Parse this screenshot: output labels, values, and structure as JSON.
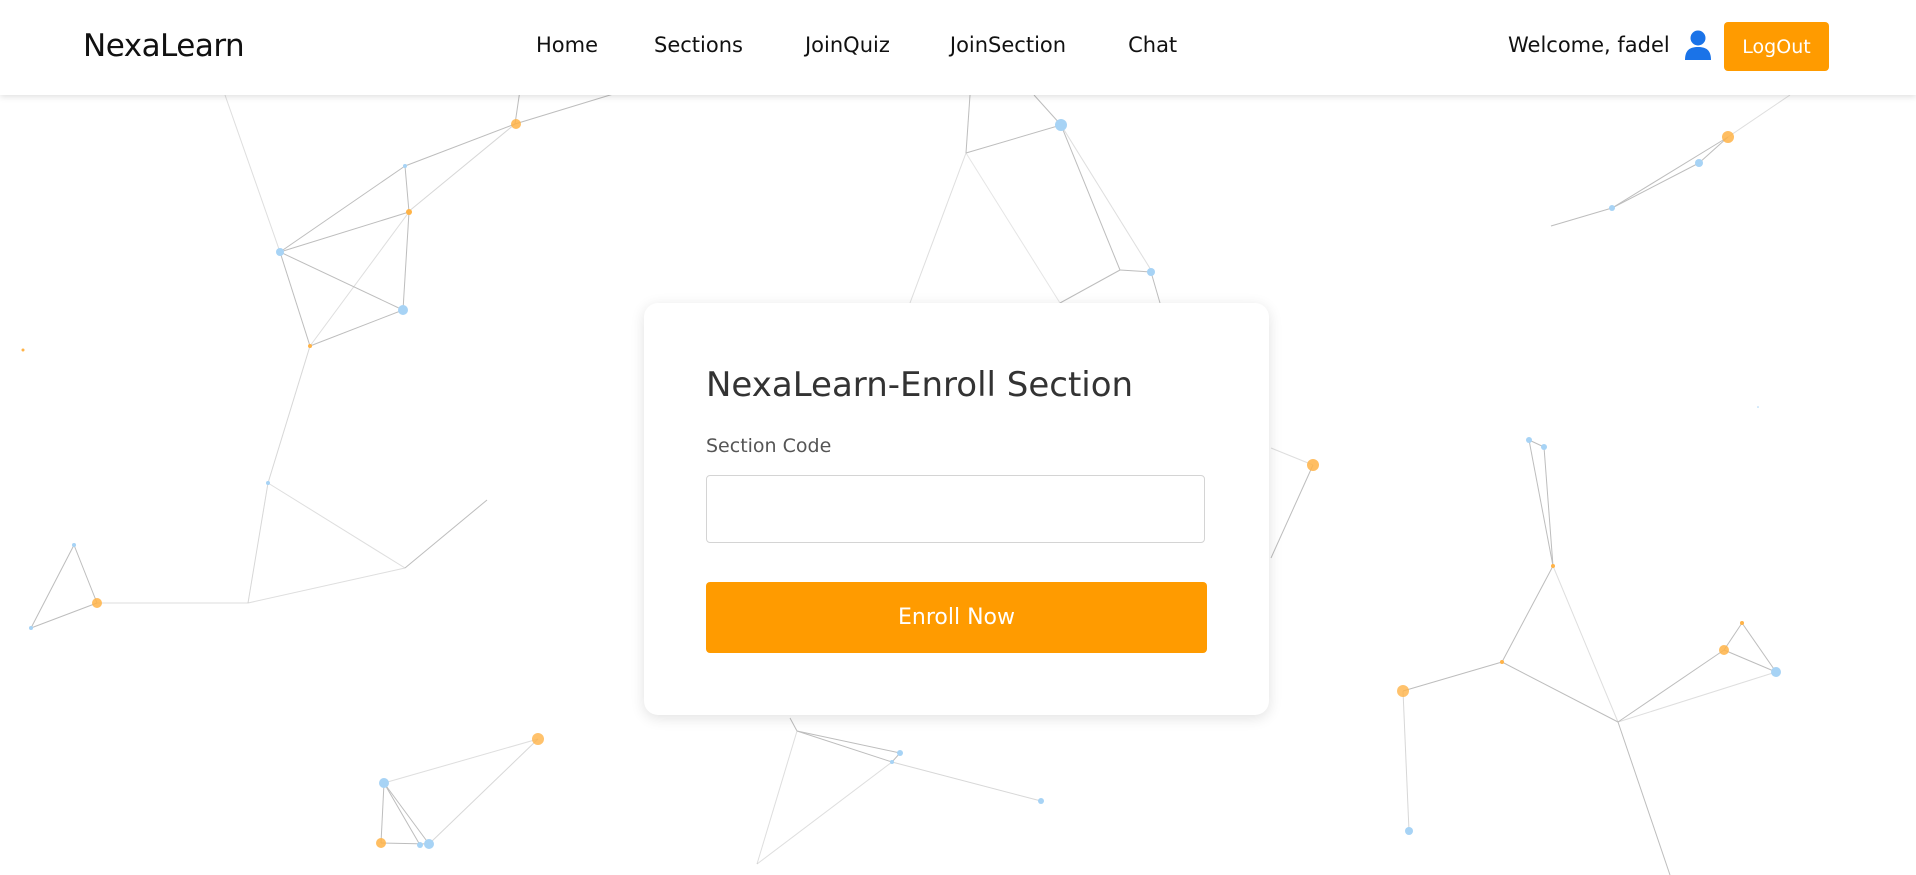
{
  "navbar": {
    "brand": "NexaLearn",
    "links": [
      "Home",
      "Sections",
      "JoinQuiz",
      "JoinSection",
      "Chat"
    ],
    "welcome": "Welcome, fadel",
    "user_icon": "user-icon",
    "logout_label": "LogOut"
  },
  "enroll": {
    "title": "NexaLearn-Enroll Section",
    "field_label": "Section Code",
    "field_value": "",
    "field_placeholder": "",
    "button_label": "Enroll Now"
  },
  "colors": {
    "accent": "#ff9b00",
    "icon_blue": "#1a73e8",
    "node_blue": "#a7d3f5",
    "node_orange": "#ffb347"
  }
}
